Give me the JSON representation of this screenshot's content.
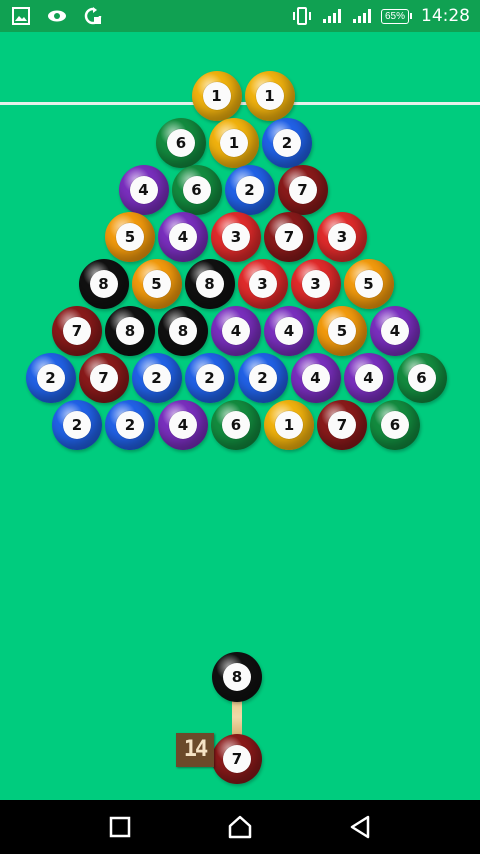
{
  "status_bar": {
    "icons_left": [
      "image-icon",
      "eye-icon",
      "sync-icon"
    ],
    "icons_right": [
      "vibrate-icon",
      "signal-icon",
      "signal-icon"
    ],
    "battery_percent": "65%",
    "time": "14:28"
  },
  "game": {
    "board_color": "#00cc7e",
    "ball_colors": {
      "1": "#f2b30e",
      "2": "#2162e8",
      "3": "#e12b2b",
      "4": "#7a2fbf",
      "5": "#f39b0d",
      "6": "#138c3f",
      "7": "#8a1a1a",
      "8": "#111111"
    },
    "rows": [
      [
        "1",
        "1"
      ],
      [
        "6",
        "1",
        "2"
      ],
      [
        "4",
        "6",
        "2",
        "7"
      ],
      [
        "5",
        "4",
        "3",
        "7",
        "3"
      ],
      [
        "8",
        "5",
        "8",
        "3",
        "3",
        "5"
      ],
      [
        "7",
        "8",
        "8",
        "4",
        "4",
        "5",
        "4"
      ],
      [
        "2",
        "7",
        "2",
        "2",
        "2",
        "4",
        "4",
        "6"
      ],
      [
        "2",
        "2",
        "4",
        "6",
        "1",
        "7",
        "6"
      ]
    ],
    "shooter_ball": "8",
    "next_ball": "7",
    "shots_left": "14"
  },
  "nav": {
    "buttons": [
      "recent-apps-button",
      "home-button",
      "back-button"
    ]
  }
}
